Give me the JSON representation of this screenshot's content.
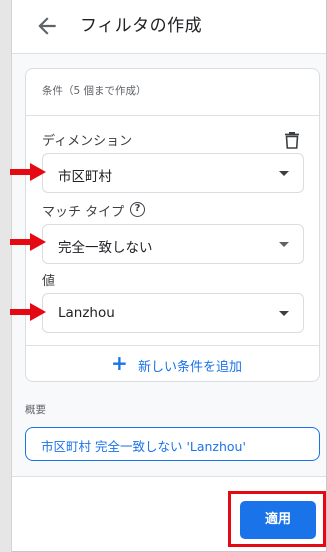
{
  "header": {
    "title": "フィルタの作成",
    "back_icon": "arrow-left-icon"
  },
  "conditions": {
    "note": "条件（5 個まで作成）",
    "dimension": {
      "label": "ディメンション",
      "value": "市区町村",
      "delete_icon": "trash-icon"
    },
    "match_type": {
      "label": "マッチ タイプ",
      "help_icon": "help-circle-icon",
      "value": "完全一致しない"
    },
    "value_field": {
      "label": "値",
      "value": "Lanzhou"
    },
    "add_condition_label": "新しい条件を追加"
  },
  "summary": {
    "label": "概要",
    "text": "市区町村 完全一致しない 'Lanzhou'"
  },
  "footer": {
    "apply_label": "適用"
  },
  "colors": {
    "accent": "#1a73e8",
    "highlight": "#e50914"
  }
}
